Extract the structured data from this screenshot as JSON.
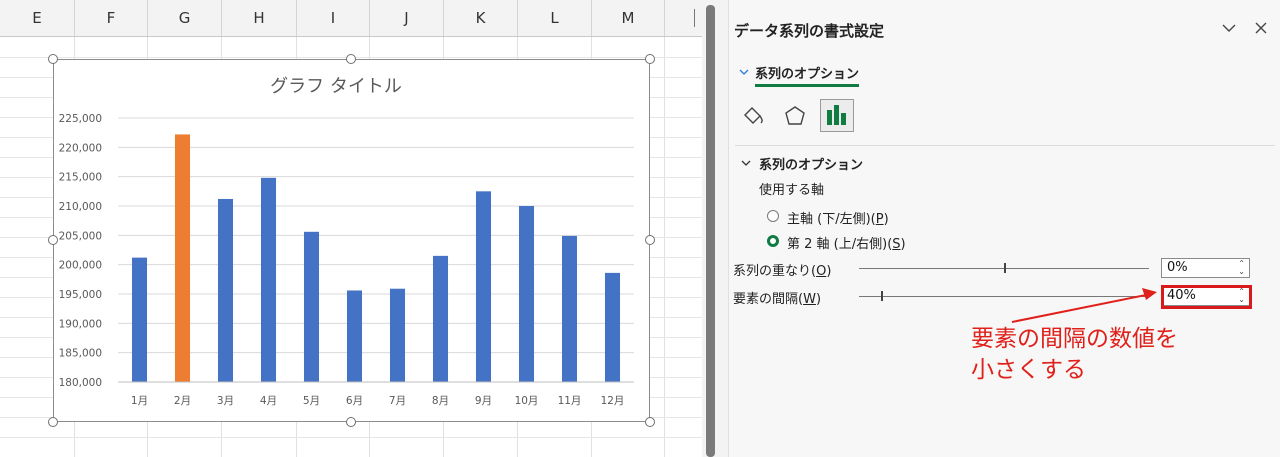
{
  "sheet": {
    "columns": [
      "E",
      "F",
      "G",
      "H",
      "I",
      "J",
      "K",
      "L",
      "M"
    ]
  },
  "chart": {
    "title": "グラフ タイトル"
  },
  "chart_data": {
    "type": "bar",
    "title": "グラフ タイトル",
    "categories": [
      "1月",
      "2月",
      "3月",
      "4月",
      "5月",
      "6月",
      "7月",
      "8月",
      "9月",
      "10月",
      "11月",
      "12月"
    ],
    "series": [
      {
        "values": [
          201200,
          222200,
          211200,
          214800,
          205600,
          195600,
          195900,
          201500,
          212500,
          210000,
          204900,
          198600
        ]
      }
    ],
    "highlight_index": 1,
    "colors": {
      "bar": "#4472c4",
      "highlight": "#ed7d31"
    },
    "ylim": [
      180000,
      225000
    ],
    "yticks": [
      "180,000",
      "185,000",
      "190,000",
      "195,000",
      "200,000",
      "205,000",
      "210,000",
      "215,000",
      "220,000",
      "225,000"
    ],
    "grid": true
  },
  "pane": {
    "title": "データ系列の書式設定",
    "tab_label": "系列のオプション",
    "section_label": "系列のオプション",
    "axis_label": "使用する軸",
    "primary_axis": {
      "main": "主軸 (下/左側)(",
      "key": "P",
      "tail": ")"
    },
    "secondary_axis": {
      "main": "第 2 軸 (上/右側)(",
      "key": "S",
      "tail": ")"
    },
    "overlap": {
      "label_main": "系列の重なり(",
      "key": "O",
      "tail": ")",
      "value": "0%",
      "level": 0.0
    },
    "gap": {
      "label_main": "要素の間隔(",
      "key": "W",
      "tail": ")",
      "value": "40%",
      "level": 0.08
    }
  },
  "annotation": {
    "text": "要素の間隔の数値を\n小さくする"
  },
  "colors": {
    "accent": "#107c41",
    "annotation": "#e0201a"
  }
}
